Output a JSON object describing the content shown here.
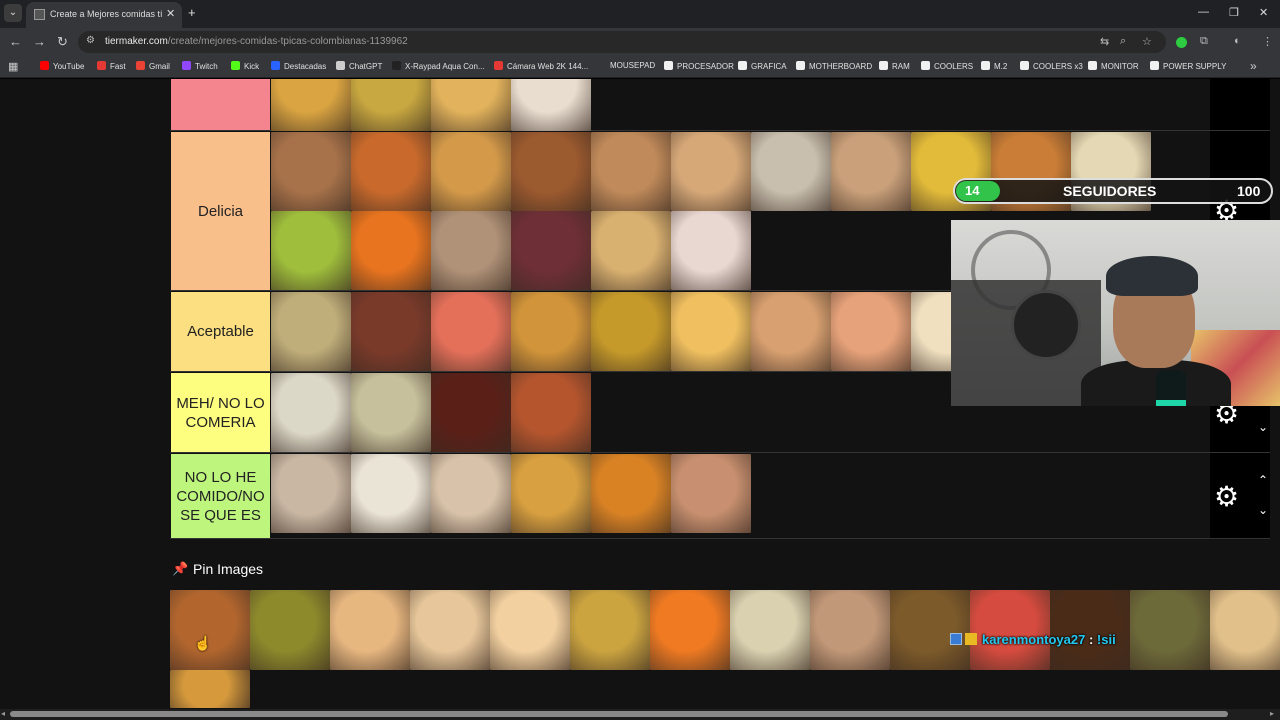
{
  "browser": {
    "tab_title": "Create a Mejores comidas típicas",
    "url_host": "tiermaker.com",
    "url_path": "/create/mejores-comidas-tpicas-colombianas-1139962",
    "bookmarks": [
      {
        "label": "YouTube",
        "color": "#ff0000"
      },
      {
        "label": "Fast",
        "color": "#e53935"
      },
      {
        "label": "Gmail",
        "color": "#ea4335"
      },
      {
        "label": "Twitch",
        "color": "#9146ff"
      },
      {
        "label": "Kick",
        "color": "#53fc18"
      },
      {
        "label": "Destacadas",
        "color": "#2962ff"
      },
      {
        "label": "ChatGPT",
        "color": "#cccccc"
      },
      {
        "label": "X-Raypad Aqua Con...",
        "color": "#222222"
      },
      {
        "label": "Cámara Web 2K 144...",
        "color": "#e53935"
      },
      {
        "label": "MOUSEPAD",
        "color": "#35363a"
      },
      {
        "label": "PROCESADOR",
        "color": "#f0f0f0"
      },
      {
        "label": "GRAFICA",
        "color": "#f0f0f0"
      },
      {
        "label": "MOTHERBOARD",
        "color": "#f0f0f0"
      },
      {
        "label": "RAM",
        "color": "#f0f0f0"
      },
      {
        "label": "COOLERS",
        "color": "#f0f0f0"
      },
      {
        "label": "M.2",
        "color": "#f0f0f0"
      },
      {
        "label": "COOLERS x3",
        "color": "#f0f0f0"
      },
      {
        "label": "MONITOR",
        "color": "#f0f0f0"
      },
      {
        "label": "POWER SUPPLY",
        "color": "#f0f0f0"
      }
    ]
  },
  "tiers": [
    {
      "label": "",
      "color": "#f4858e"
    },
    {
      "label": "Delicia",
      "color": "#f9bf8b"
    },
    {
      "label": "Aceptable",
      "color": "#fbdf80"
    },
    {
      "label": "MEH/ NO LO COMERIA",
      "color": "#fdfd7f"
    },
    {
      "label": "NO LO HE COMIDO/NO SE QUE ES",
      "color": "#bef67d"
    }
  ],
  "pin_images": {
    "title": "Pin Images"
  },
  "overlay": {
    "follower_count": "14",
    "follower_label": "SEGUIDORES",
    "follower_goal": "100",
    "follower_progress": 0.14,
    "chat_user": "karenmontoya27",
    "chat_colon": ":",
    "chat_text": "!sii"
  },
  "food_colors": {
    "row0": [
      "#d9a441",
      "#c8a840",
      "#e2b35c",
      "#e9ddd0"
    ],
    "row1a": [
      "#a7724a",
      "#c96a2c",
      "#d49a4a",
      "#9c5a2f",
      "#c08a5a",
      "#d6a878",
      "#c8bfae",
      "#c9a07a",
      "#e2bb3a",
      "#c97d36",
      "#e5d8b4"
    ],
    "row1b": [
      "#9fbf3c",
      "#e8741f",
      "#b09278",
      "#6e2f36",
      "#d8b070",
      "#e9d8d2"
    ],
    "row2": [
      "#bfae7a",
      "#7a3a2a",
      "#e4705a",
      "#d1943a",
      "#c69a2a",
      "#f0c060",
      "#d8a070",
      "#e6a27a",
      "#f0e0c0"
    ],
    "row3": [
      "#dcd8c8",
      "#c6c09c",
      "#5a2018",
      "#b4552e"
    ],
    "row4": [
      "#c9b7a4",
      "#eae4d6",
      "#d8c3aa",
      "#d8a040",
      "#d88224",
      "#c89070"
    ],
    "pin": [
      "#b2662e",
      "#8d8a2c",
      "#e7b780",
      "#e6c69a",
      "#f2d0a0",
      "#cba440",
      "#ef7a22",
      "#d9d1b0",
      "#c19878",
      "#7c5a2a",
      "#d64b3f",
      "#4a2b18",
      "#6d6a3a",
      "#e1c08a"
    ],
    "pin2": [
      "#d69a3c"
    ]
  }
}
